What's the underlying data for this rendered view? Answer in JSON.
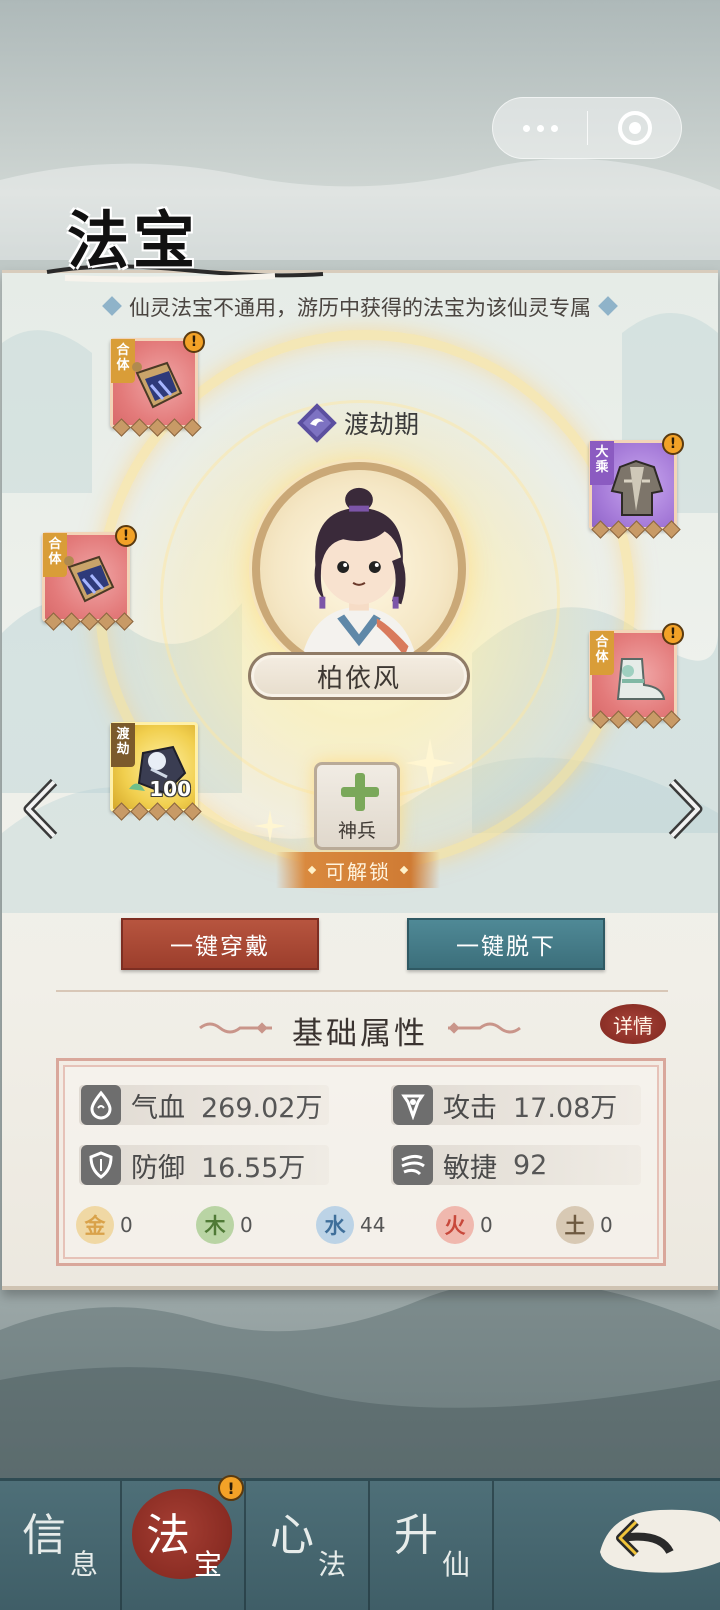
{
  "capsule": {
    "more_icon": "more-dots-icon",
    "close_icon": "target-circle-icon"
  },
  "header": {
    "title": "法宝"
  },
  "notice": "仙灵法宝不通用，游历中获得的法宝为该仙灵专属",
  "character": {
    "realm": "渡劫期",
    "name": "柏依风"
  },
  "items": [
    {
      "tag": "合体",
      "slot": "left-top",
      "has_alert": true,
      "alert": "!"
    },
    {
      "tag": "合体",
      "slot": "left-middle",
      "has_alert": true,
      "alert": "!"
    },
    {
      "tag": "渡劫",
      "slot": "left-bottom",
      "count": "100"
    },
    {
      "tag": "大乘",
      "slot": "right-top",
      "has_alert": true,
      "alert": "!"
    },
    {
      "tag": "合体",
      "slot": "right-middle",
      "has_alert": true,
      "alert": "!"
    }
  ],
  "weapon": {
    "label": "神兵",
    "unlock": "可解锁"
  },
  "buttons": {
    "equip_all": "一键穿戴",
    "remove_all": "一键脱下"
  },
  "attributes": {
    "title": "基础属性",
    "detail": "详情",
    "stats": [
      {
        "label": "气血",
        "value": "269.02万",
        "icon": "blood-drop-icon"
      },
      {
        "label": "攻击",
        "value": "17.08万",
        "icon": "attack-icon"
      },
      {
        "label": "防御",
        "value": "16.55万",
        "icon": "shield-icon"
      },
      {
        "label": "敏捷",
        "value": "92",
        "icon": "wind-icon"
      }
    ],
    "elements": [
      {
        "char": "金",
        "value": "0",
        "color": "#d9a24a"
      },
      {
        "char": "木",
        "value": "0",
        "color": "#6f9a4f"
      },
      {
        "char": "水",
        "value": "44",
        "color": "#5f8fb8"
      },
      {
        "char": "火",
        "value": "0",
        "color": "#c8483b"
      },
      {
        "char": "土",
        "value": "0",
        "color": "#8c7357"
      }
    ]
  },
  "tabs": [
    {
      "big": "信",
      "small": "息"
    },
    {
      "big": "法",
      "small": "宝",
      "active": true
    },
    {
      "big": "心",
      "small": "法"
    },
    {
      "big": "升",
      "small": "仙"
    }
  ],
  "tab_alert": "!",
  "colors": {
    "accent_red": "#9c3e2c",
    "accent_teal": "#3c6f7b",
    "tabbar": "#4e6f78"
  }
}
